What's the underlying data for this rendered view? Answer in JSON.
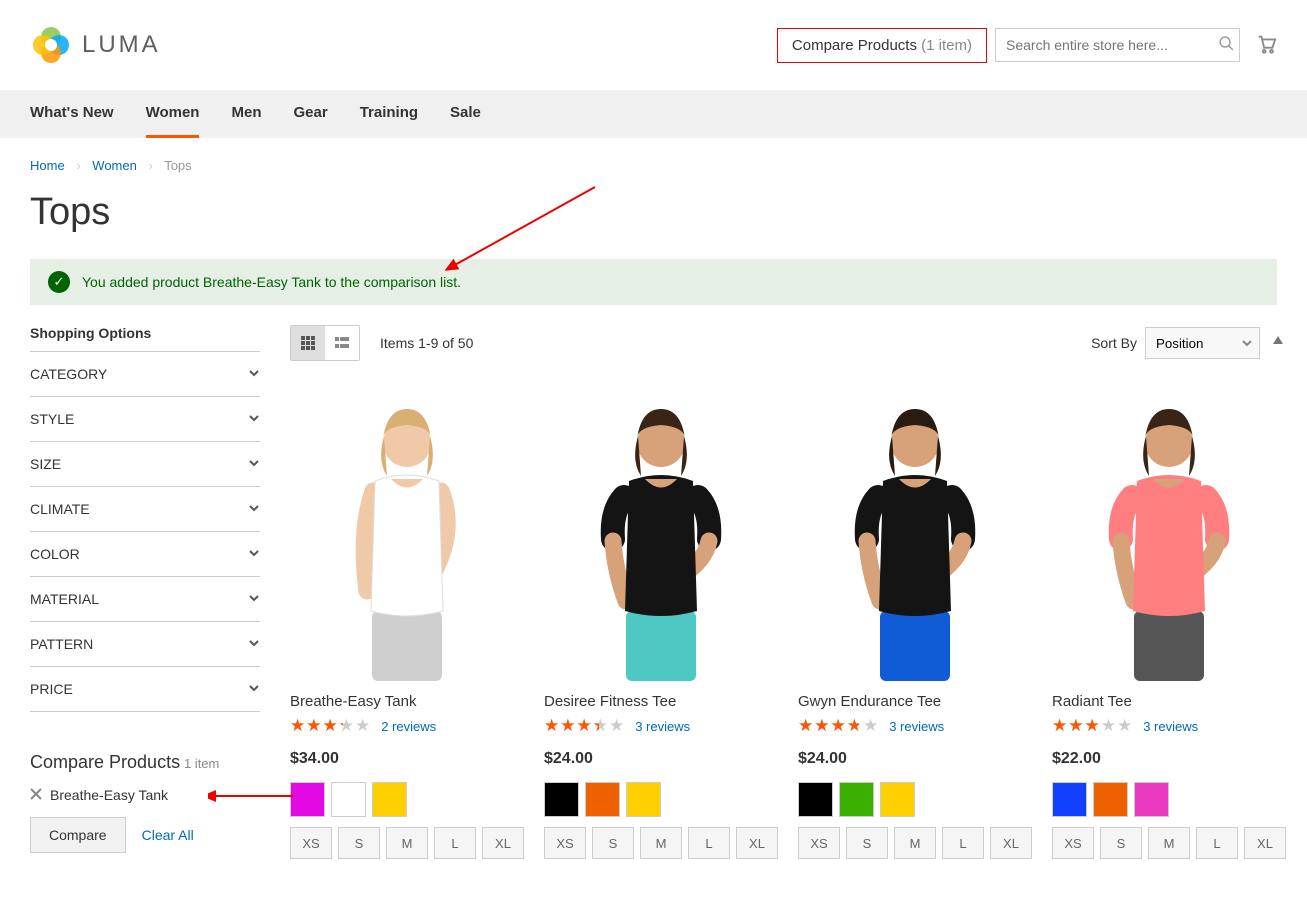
{
  "header": {
    "brand": "LUMA",
    "compare_label": "Compare Products",
    "compare_count": "(1 item)",
    "search_placeholder": "Search entire store here..."
  },
  "nav": [
    {
      "label": "What's New",
      "active": false
    },
    {
      "label": "Women",
      "active": true
    },
    {
      "label": "Men",
      "active": false
    },
    {
      "label": "Gear",
      "active": false
    },
    {
      "label": "Training",
      "active": false
    },
    {
      "label": "Sale",
      "active": false
    }
  ],
  "breadcrumbs": {
    "home": "Home",
    "women": "Women",
    "current": "Tops"
  },
  "page_title": "Tops",
  "message": "You added product Breathe-Easy Tank to the comparison list.",
  "toolbar": {
    "amount": "Items 1-9 of 50",
    "sort_label": "Sort By",
    "sort_value": "Position"
  },
  "filters_title": "Shopping Options",
  "filters": [
    "CATEGORY",
    "STYLE",
    "SIZE",
    "CLIMATE",
    "COLOR",
    "MATERIAL",
    "PATTERN",
    "PRICE"
  ],
  "compare_block": {
    "title": "Compare Products",
    "count": "1 item",
    "item": "Breathe-Easy Tank",
    "compare_btn": "Compare",
    "clear": "Clear All"
  },
  "sizes": [
    "XS",
    "S",
    "M",
    "L",
    "XL"
  ],
  "products": [
    {
      "name": "Breathe-Easy Tank",
      "rating": 65,
      "reviews": "2 reviews",
      "price": "$34.00",
      "colors": [
        "#e409e4",
        "#ffffff",
        "#ffd000"
      ],
      "shirt": "#ffffff",
      "sleeves": false,
      "skin": "#f0c9a8",
      "hair": "#d9b074",
      "bottoms": "#cfcfcf"
    },
    {
      "name": "Desiree Fitness Tee",
      "rating": 68,
      "reviews": "3 reviews",
      "price": "$24.00",
      "colors": [
        "#000000",
        "#ef6000",
        "#ffd000"
      ],
      "shirt": "#141414",
      "sleeves": true,
      "skin": "#d7a17a",
      "hair": "#3a2416",
      "bottoms": "#4ec8c2"
    },
    {
      "name": "Gwyn Endurance Tee",
      "rating": 75,
      "reviews": "3 reviews",
      "price": "$24.00",
      "colors": [
        "#000000",
        "#3ab000",
        "#ffd000"
      ],
      "shirt": "#141414",
      "sleeves": true,
      "skin": "#d7a17a",
      "hair": "#2a1b10",
      "bottoms": "#105bd6"
    },
    {
      "name": "Radiant Tee",
      "rating": 58,
      "reviews": "3 reviews",
      "price": "$22.00",
      "colors": [
        "#1141ff",
        "#ef6000",
        "#e83ac0"
      ],
      "shirt": "#ff7f80",
      "sleeves": true,
      "skin": "#d7a17a",
      "hair": "#3a2416",
      "bottoms": "#555555"
    }
  ]
}
